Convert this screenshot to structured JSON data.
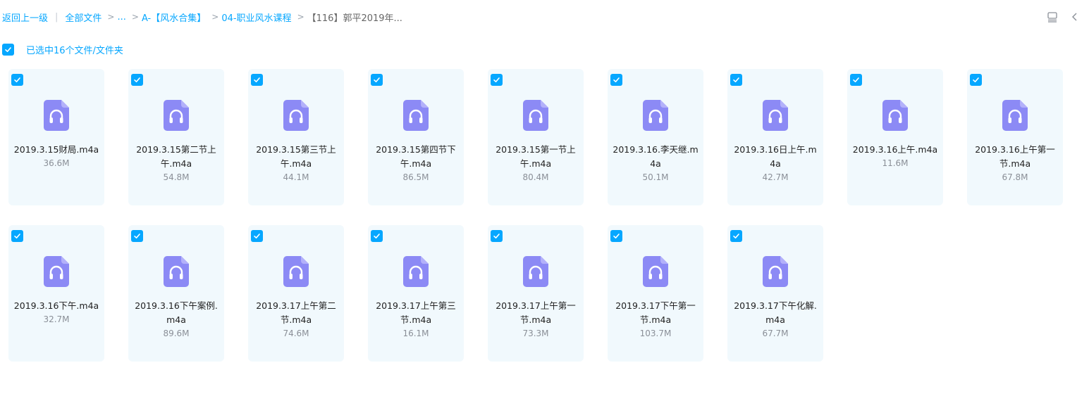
{
  "breadcrumb": {
    "back": "返回上一级",
    "all_files": "全部文件",
    "ellipsis": "...",
    "level1": "A-【风水合集】",
    "level2": "04-职业风水课程",
    "current": "【116】郭平2019年..."
  },
  "selection": {
    "label": "已选中16个文件/文件夹"
  },
  "files": [
    {
      "name": "2019.3.15财局.m4a",
      "size": "36.6M"
    },
    {
      "name": "2019.3.15第二节上午.m4a",
      "size": "54.8M"
    },
    {
      "name": "2019.3.15第三节上午.m4a",
      "size": "44.1M"
    },
    {
      "name": "2019.3.15第四节下午.m4a",
      "size": "86.5M"
    },
    {
      "name": "2019.3.15第一节上午.m4a",
      "size": "80.4M"
    },
    {
      "name": "2019.3.16.李天继.m4a",
      "size": "50.1M"
    },
    {
      "name": "2019.3.16日上午.m4a",
      "size": "42.7M"
    },
    {
      "name": "2019.3.16上午.m4a",
      "size": "11.6M"
    },
    {
      "name": "2019.3.16上午第一节.m4a",
      "size": "67.8M"
    },
    {
      "name": "2019.3.16下午.m4a",
      "size": "32.7M"
    },
    {
      "name": "2019.3.16下午案例.m4a",
      "size": "89.6M"
    },
    {
      "name": "2019.3.17上午第二节.m4a",
      "size": "74.6M"
    },
    {
      "name": "2019.3.17上午第三节.m4a",
      "size": "16.1M"
    },
    {
      "name": "2019.3.17上午第一节.m4a",
      "size": "73.3M"
    },
    {
      "name": "2019.3.17下午第一节.m4a",
      "size": "103.7M"
    },
    {
      "name": "2019.3.17下午化解.m4a",
      "size": "67.7M"
    }
  ],
  "icons": {
    "file": "headphones-audio-icon",
    "list_view": "list-view-icon",
    "collapse": "chevron-left-icon"
  },
  "colors": {
    "accent": "#06a7ff",
    "card_bg": "#f1f9fd",
    "audio_icon": "#8c8af5"
  }
}
